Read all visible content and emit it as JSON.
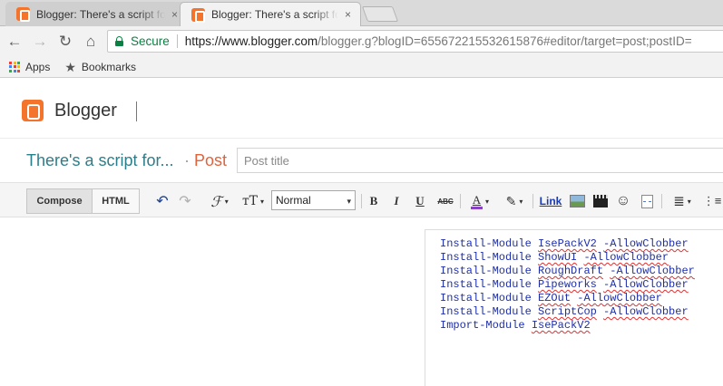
{
  "browser": {
    "tabs": [
      {
        "title": "Blogger: There's a script for...",
        "close": "×",
        "active": false
      },
      {
        "title": "Blogger: There's a script for...",
        "close": "×",
        "active": true
      }
    ],
    "nav": {
      "back": "←",
      "forward": "→",
      "reload": "↻",
      "home": "⌂"
    },
    "address": {
      "secure_label": "Secure",
      "url_main": "https://www.blogger.com",
      "url_rest": "/blogger.g?blogID=655672215532615876#editor/target=post;postID="
    },
    "bookmarks": [
      {
        "label": "Apps",
        "icon": "apps-grid-icon"
      },
      {
        "label": "Bookmarks",
        "icon": "star-icon"
      }
    ]
  },
  "blogger": {
    "brand": "Blogger",
    "colors": {
      "brand": "#f4742c",
      "blog_name": "#2b7f8a",
      "post_label": "#e2623a"
    },
    "blog_name": "There's a script for...",
    "separator": "·",
    "post_label": "Post",
    "post_title_placeholder": "Post title"
  },
  "editor": {
    "modes": {
      "compose": "Compose",
      "html": "HTML"
    },
    "toolbar": {
      "undo": "↶",
      "redo": "↷",
      "font_glyph": "ℱ",
      "size_glyph": "тT",
      "format_value": "Normal",
      "bold": "B",
      "italic": "I",
      "underline": "U",
      "strike": "ABC",
      "text_color": "A",
      "highlight": "✎",
      "link": "Link",
      "emoji": "☺",
      "align": "≣",
      "list": "⋮≡",
      "dropdown": "▾"
    },
    "lines": [
      {
        "cmd": "Install-Module ",
        "module": "IsePackV2",
        "flag": "-AllowClobber"
      },
      {
        "cmd": "Install-Module ",
        "module": "ShowUI",
        "flag": "-AllowClobber"
      },
      {
        "cmd": "Install-Module ",
        "module": "RoughDraft",
        "flag": "-AllowClobber"
      },
      {
        "cmd": "Install-Module ",
        "module": "Pipeworks",
        "flag": "-AllowClobber"
      },
      {
        "cmd": "Install-Module ",
        "module": "EZOut",
        "flag": "-AllowClobber"
      },
      {
        "cmd": "Install-Module ",
        "module": "ScriptCop",
        "flag": "-AllowClobber"
      },
      {
        "cmd": "Import-Module ",
        "module": "IsePackV2",
        "flag": ""
      }
    ]
  }
}
